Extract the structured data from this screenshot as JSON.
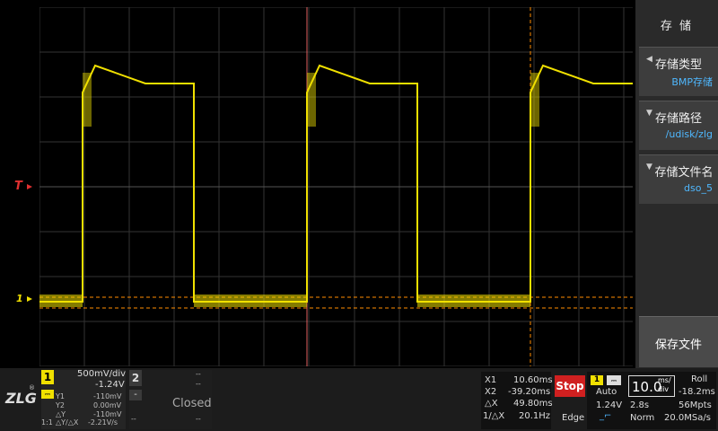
{
  "colors": {
    "trace": "#f0e000",
    "trigger": "#e03030",
    "cursor": "#ff8c00",
    "grid": "#3a3a3a",
    "menu_value": "#4fb8ff"
  },
  "markers": {
    "trigger": "T",
    "channel": "1"
  },
  "menu": {
    "title": "存 储",
    "items": [
      {
        "label": "存储类型",
        "value": "BMP存储"
      },
      {
        "label": "存储路径",
        "value": "/udisk/zlg"
      },
      {
        "label": "存储文件名",
        "value": "dso_5"
      }
    ],
    "save_button": "保存文件"
  },
  "logo": {
    "text": "ZLG",
    "reg": "®"
  },
  "ch1": {
    "number": "1",
    "coupling": "DC",
    "volts_div": "500mV/div",
    "offset": "-1.24V",
    "y1_label": "Y1",
    "y1_value": "-110mV",
    "y2_label": "Y2",
    "y2_value": "0.00mV",
    "dy_label": "△Y",
    "dy_value": "-110mV",
    "probe": "1:1",
    "dydx_label": "△Y/△X",
    "dydx_value": "-2.21V/s"
  },
  "ch2": {
    "number": "2",
    "minus": "-",
    "dash1": "--",
    "dash2": "--",
    "dash3": "--",
    "dash4": "--",
    "status": "Closed"
  },
  "cursors": {
    "x1_label": "X1",
    "x1_value": "10.60ms",
    "x2_label": "X2",
    "x2_value": "-39.20ms",
    "dx_label": "△X",
    "dx_value": "49.80ms",
    "inv_label": "1/△X",
    "inv_value": "20.1Hz"
  },
  "run_state": "Stop",
  "trigger": {
    "channel": "1",
    "mode": "Auto",
    "level": "1.24V",
    "type": "Edge"
  },
  "timebase": {
    "value": "10.0",
    "unit_top": "ms/",
    "unit_bottom": "div",
    "mode": "Roll",
    "offset": "-18.2ms",
    "length": "2.8s",
    "points": "56Mpts",
    "acq": "Norm",
    "sample_rate": "20.0MSa/s"
  }
}
